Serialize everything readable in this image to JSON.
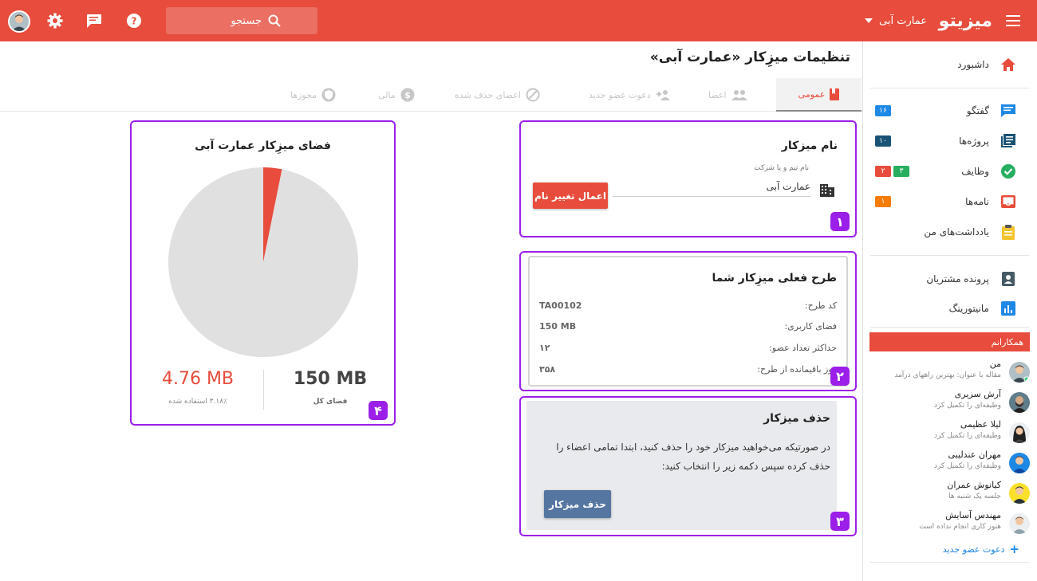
{
  "topbar": {
    "brand": "میزیتو",
    "workspace": "عمارت آبی",
    "search_placeholder": "جستجو",
    "icons": [
      "menu-icon",
      "dropdown-arrow-icon",
      "search-icon",
      "help-icon",
      "chat-icon",
      "settings-icon",
      "user-avatar"
    ]
  },
  "sidebar": {
    "items": [
      {
        "label": "داشبورد",
        "icon": "home-icon"
      },
      {
        "label": "گفتگو",
        "icon": "chat-icon",
        "badge": "۱۶",
        "badge_color": "#1e88e5"
      },
      {
        "label": "پروژه‌ها",
        "icon": "projects-icon",
        "badge": "۱۰",
        "badge_color": "#1a5276"
      },
      {
        "label": "وظایف",
        "icon": "tasks-check-icon",
        "badges": [
          {
            "text": "۳",
            "color": "#27ae60"
          },
          {
            "text": "۲",
            "color": "#e74c3c"
          }
        ]
      },
      {
        "label": "نامه‌ها",
        "icon": "inbox-icon",
        "badge": "۱",
        "badge_color": "#f57c00"
      },
      {
        "label": "یادداشت‌های من",
        "icon": "notes-icon"
      },
      {
        "label": "پرونده مشتریان",
        "icon": "customer-file-icon"
      },
      {
        "label": "مانیتورینگ",
        "icon": "monitoring-icon"
      }
    ],
    "colleagues_title": "همکارانم",
    "colleagues": [
      {
        "name": "من",
        "status": "مقاله با عنوان: بهترین راههای درآمد"
      },
      {
        "name": "آرش سریری",
        "status": "وظیفه‌ای را تکمیل کرد"
      },
      {
        "name": "لیلا عظیمی",
        "status": "وظیفه‌ای را تکمیل کرد"
      },
      {
        "name": "مهران عندلیبی",
        "status": "وظیفه‌ای را تکمیل کرد"
      },
      {
        "name": "کیانوش عمران",
        "status": "جلسه یک شنبه ها"
      },
      {
        "name": "مهندس آسایش",
        "status": "هنوز کاری انجام نداده است"
      }
    ],
    "invite_label": "دعوت عضو جدید"
  },
  "main": {
    "title": "تنظیمات میزِکار «عمارت آبی»",
    "tabs": [
      {
        "label": "عمومی",
        "active": true
      },
      {
        "label": "اعضا"
      },
      {
        "label": "دعوت عضو جدید"
      },
      {
        "label": "اعضای حذف شده"
      },
      {
        "label": "مالی"
      },
      {
        "label": "مجوزها"
      }
    ]
  },
  "workspace_name": {
    "title": "نام میزکار",
    "field_label": "نام تیم و یا شرکت",
    "field_value": "عمارت آبی",
    "button": "اعمال تغییر نام",
    "marker": "۱"
  },
  "plan": {
    "title": "طرح فعلی میزِکار شما",
    "rows": [
      {
        "key": "کد طرح:",
        "value": "TA00102"
      },
      {
        "key": "فضای کاربری:",
        "value": "150 MB"
      },
      {
        "key": "حداکثر تعداد عضو:",
        "value": "۱۲"
      },
      {
        "key": "روز باقیمانده از طرح:",
        "value": "۳۵۸"
      }
    ],
    "marker": "۲"
  },
  "delete": {
    "title": "حذف میزکار",
    "text": "در صورتیکه می‌خواهید میزکار خود را حذف کنید، ابتدا تمامی اعضاء را حذف کرده سپس دکمه زیر را انتخاب کنید:",
    "button": "حذف میزکار",
    "marker": "۳"
  },
  "storage": {
    "title": "فضای میزِکار عمارت آبی",
    "total_value": "150 MB",
    "total_label": "فضای کل",
    "used_value": "4.76 MB",
    "used_label": "۳.۱۸٪ استفاده شده",
    "marker": "۴",
    "colors": {
      "used": "#e74c3c",
      "free": "#e0e0e0"
    }
  },
  "chart_data": {
    "type": "pie",
    "slices": [
      {
        "label": "used",
        "value": 4.76
      },
      {
        "label": "free",
        "value": 145.24
      }
    ]
  }
}
